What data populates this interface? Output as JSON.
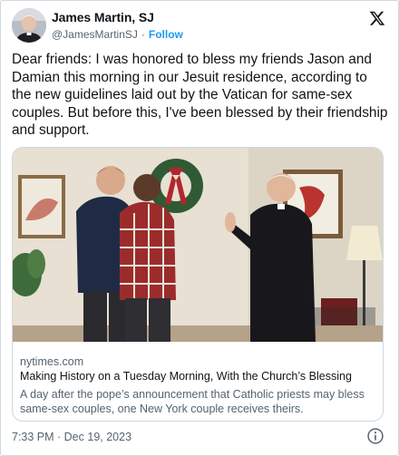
{
  "author": {
    "name": "James Martin, SJ",
    "handle": "@JamesMartinSJ",
    "separator": "·",
    "follow_label": "Follow"
  },
  "tweet": {
    "text": "Dear friends: I was honored to bless my friends Jason and Damian this morning in our Jesuit residence, according to the new guidelines laid out by the Vatican for same-sex couples. But before this, I've been blessed by their friendship and support."
  },
  "card": {
    "domain": "nytimes.com",
    "title": "Making History on a Tuesday Morning, With the Church’s Blessing",
    "description": "A day after the pope’s announcement that Catholic priests may bless same-sex couples, one New York couple receives theirs."
  },
  "footer": {
    "timestamp": "7:33 PM · Dec 19, 2023"
  },
  "icons": {
    "brand": "x-logo-icon",
    "info": "info-icon"
  },
  "colors": {
    "link_blue": "#1d9bf0",
    "text_primary": "#0f1419",
    "text_secondary": "#536471",
    "border": "#cfd9de"
  }
}
